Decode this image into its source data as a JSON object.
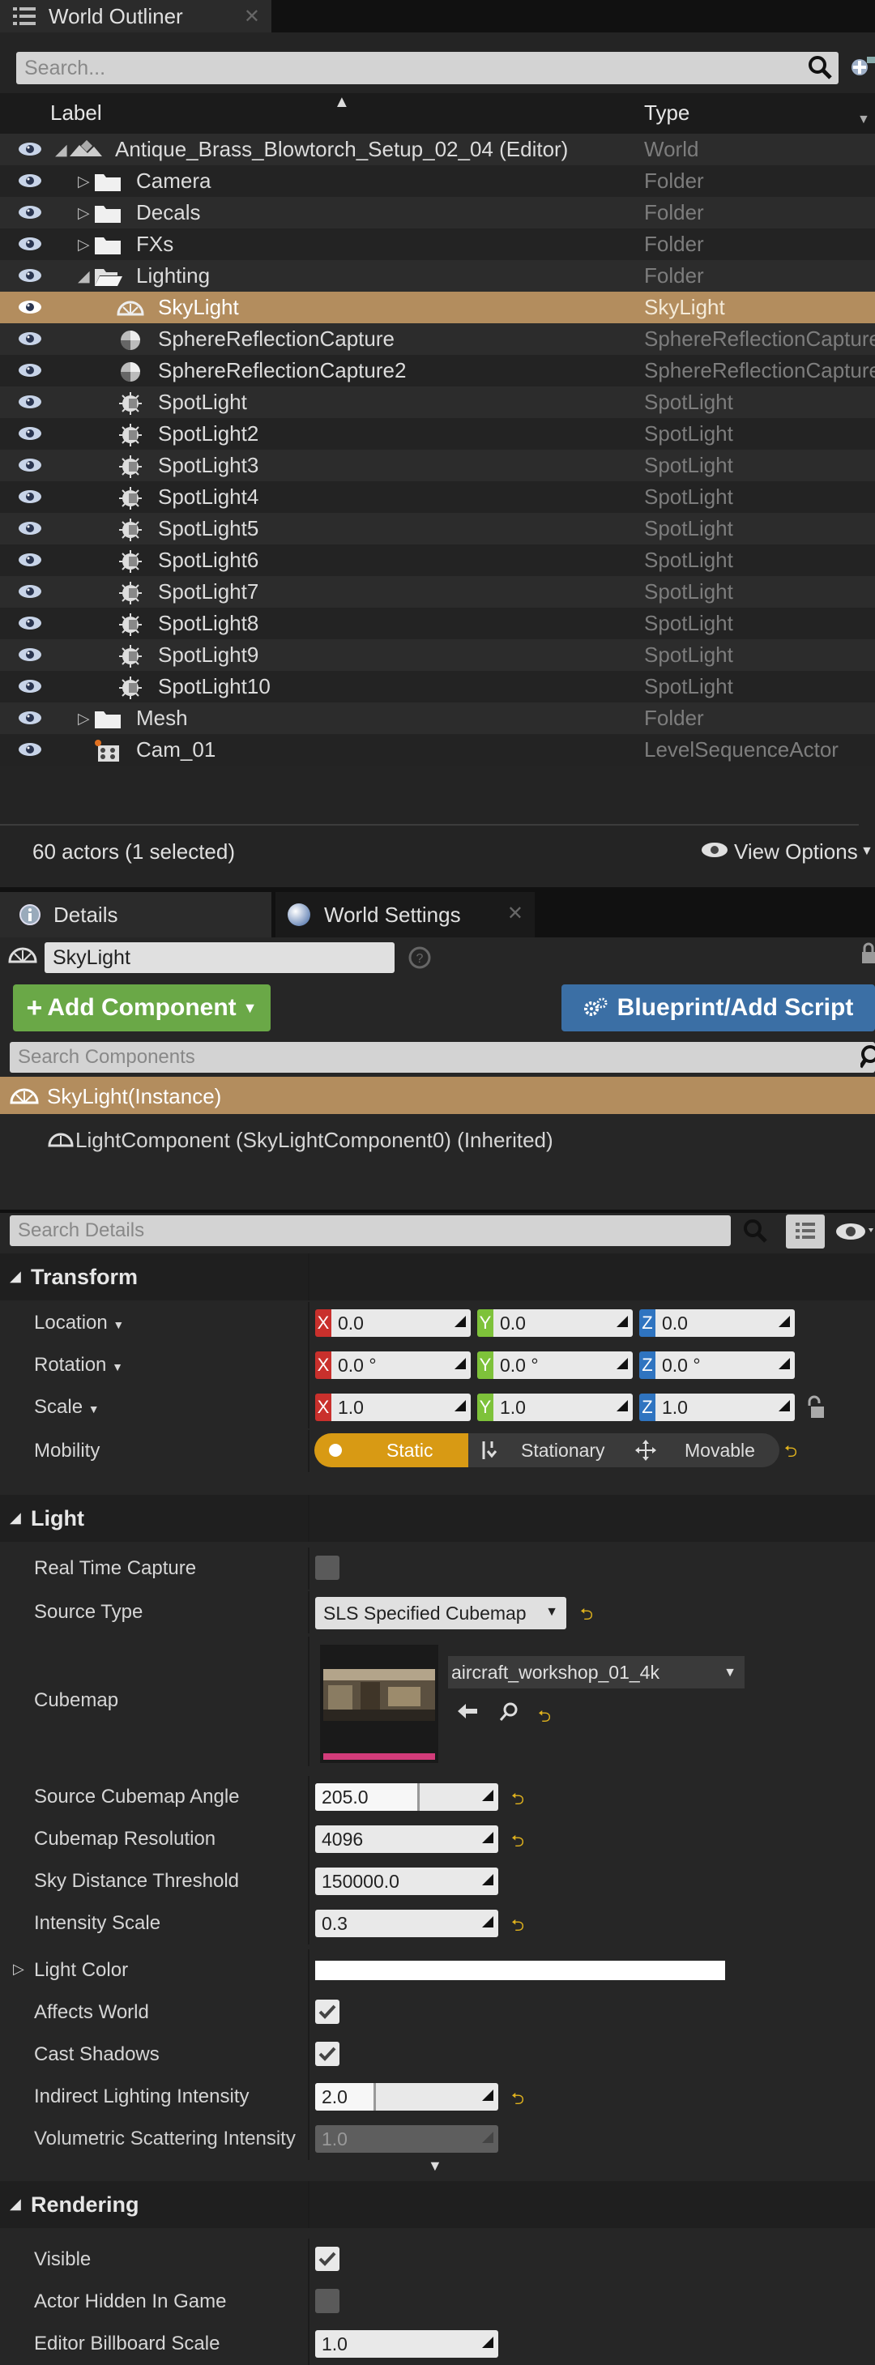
{
  "outliner": {
    "tab_title": "World Outliner",
    "search_placeholder": "Search...",
    "col_label": "Label",
    "col_type": "Type",
    "rows": [
      {
        "label": "Antique_Brass_Blowtorch_Setup_02_04 (Editor)",
        "type": "World",
        "icon": "world-icon",
        "indent": 0,
        "expander": "open"
      },
      {
        "label": "Camera",
        "type": "Folder",
        "icon": "folder-icon",
        "indent": 1,
        "expander": "closed"
      },
      {
        "label": "Decals",
        "type": "Folder",
        "icon": "folder-icon",
        "indent": 1,
        "expander": "closed"
      },
      {
        "label": "FXs",
        "type": "Folder",
        "icon": "folder-icon",
        "indent": 1,
        "expander": "closed"
      },
      {
        "label": "Lighting",
        "type": "Folder",
        "icon": "folder-open-icon",
        "indent": 1,
        "expander": "open"
      },
      {
        "label": "SkyLight",
        "type": "SkyLight",
        "icon": "skylight-icon",
        "indent": 2,
        "expander": "",
        "selected": true
      },
      {
        "label": "SphereReflectionCapture",
        "type": "SphereReflectionCapture",
        "icon": "reflection-capture-icon",
        "indent": 2,
        "expander": ""
      },
      {
        "label": "SphereReflectionCapture2",
        "type": "SphereReflectionCapture",
        "icon": "reflection-capture-icon",
        "indent": 2,
        "expander": ""
      },
      {
        "label": "SpotLight",
        "type": "SpotLight",
        "icon": "spotlight-icon",
        "indent": 2,
        "expander": ""
      },
      {
        "label": "SpotLight2",
        "type": "SpotLight",
        "icon": "spotlight-icon",
        "indent": 2,
        "expander": ""
      },
      {
        "label": "SpotLight3",
        "type": "SpotLight",
        "icon": "spotlight-icon",
        "indent": 2,
        "expander": ""
      },
      {
        "label": "SpotLight4",
        "type": "SpotLight",
        "icon": "spotlight-icon",
        "indent": 2,
        "expander": ""
      },
      {
        "label": "SpotLight5",
        "type": "SpotLight",
        "icon": "spotlight-icon",
        "indent": 2,
        "expander": ""
      },
      {
        "label": "SpotLight6",
        "type": "SpotLight",
        "icon": "spotlight-icon",
        "indent": 2,
        "expander": ""
      },
      {
        "label": "SpotLight7",
        "type": "SpotLight",
        "icon": "spotlight-icon",
        "indent": 2,
        "expander": ""
      },
      {
        "label": "SpotLight8",
        "type": "SpotLight",
        "icon": "spotlight-icon",
        "indent": 2,
        "expander": ""
      },
      {
        "label": "SpotLight9",
        "type": "SpotLight",
        "icon": "spotlight-icon",
        "indent": 2,
        "expander": ""
      },
      {
        "label": "SpotLight10",
        "type": "SpotLight",
        "icon": "spotlight-icon",
        "indent": 2,
        "expander": ""
      },
      {
        "label": "Mesh",
        "type": "Folder",
        "icon": "folder-icon",
        "indent": 1,
        "expander": "closed"
      },
      {
        "label": "Cam_01",
        "type": "LevelSequenceActor",
        "icon": "level-sequence-icon",
        "indent": 1,
        "expander": ""
      }
    ],
    "status": "60 actors (1 selected)",
    "view_options": "View Options"
  },
  "details": {
    "tab_details": "Details",
    "tab_world_settings": "World Settings",
    "actor_name": "SkyLight",
    "add_component": "Add Component",
    "blueprint_script": "Blueprint/Add Script",
    "search_components_placeholder": "Search Components",
    "instance_label": "SkyLight(Instance)",
    "component_label": "LightComponent (SkyLightComponent0) (Inherited)",
    "search_details_placeholder": "Search Details",
    "transform": {
      "header": "Transform",
      "location_label": "Location",
      "rotation_label": "Rotation",
      "scale_label": "Scale",
      "mobility_label": "Mobility",
      "location": [
        "0.0",
        "0.0",
        "0.0"
      ],
      "rotation": [
        "0.0 °",
        "0.0 °",
        "0.0 °"
      ],
      "scale": [
        "1.0",
        "1.0",
        "1.0"
      ],
      "axis_x": "X",
      "axis_y": "Y",
      "axis_z": "Z",
      "mob_static": "Static",
      "mob_stationary": "Stationary",
      "mob_movable": "Movable"
    },
    "light": {
      "header": "Light",
      "real_time_capture": "Real Time Capture",
      "source_type_label": "Source Type",
      "source_type_value": "SLS Specified Cubemap",
      "cubemap_label": "Cubemap",
      "cubemap_asset": "aircraft_workshop_01_4k",
      "source_cubemap_angle_label": "Source Cubemap Angle",
      "source_cubemap_angle": "205.0",
      "source_cubemap_angle_fill": 0.57,
      "cubemap_resolution_label": "Cubemap Resolution",
      "cubemap_resolution": "4096",
      "sky_distance_label": "Sky Distance Threshold",
      "sky_distance": "150000.0",
      "intensity_scale_label": "Intensity Scale",
      "intensity_scale": "0.3",
      "light_color_label": "Light Color",
      "affects_world_label": "Affects World",
      "cast_shadows_label": "Cast Shadows",
      "indirect_label": "Indirect Lighting Intensity",
      "indirect_value": "2.0",
      "indirect_fill": 0.33,
      "volumetric_label": "Volumetric Scattering Intensity",
      "volumetric_value": "1.0"
    },
    "rendering": {
      "header": "Rendering",
      "visible_label": "Visible",
      "actor_hidden_label": "Actor Hidden In Game",
      "billboard_label": "Editor Billboard Scale",
      "billboard_value": "1.0"
    }
  },
  "colors": {
    "selection": "#b38d5e",
    "static_active": "#d89a14",
    "green_button": "#6aa847",
    "blue_button": "#3b6fa5"
  }
}
